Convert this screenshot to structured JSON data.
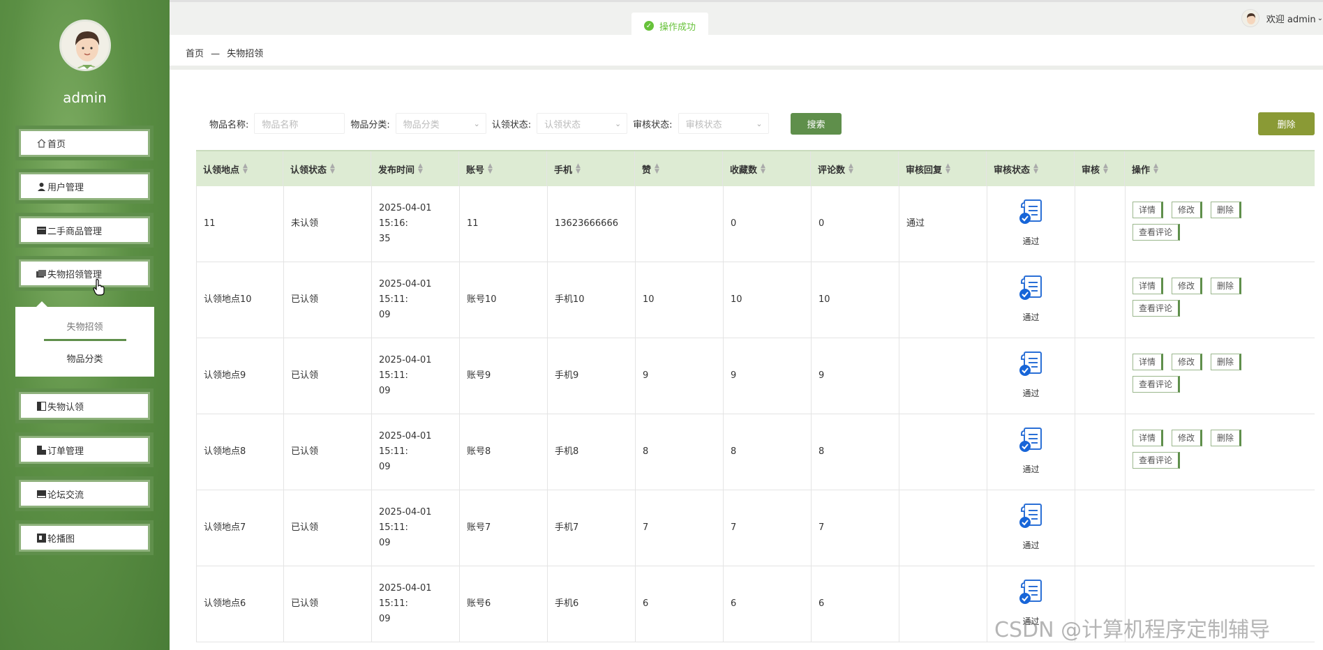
{
  "sidebar": {
    "username": "admin",
    "items": [
      {
        "label": "首页",
        "icon": "home-icon"
      },
      {
        "label": "用户管理",
        "icon": "user-icon"
      },
      {
        "label": "二手商品管理",
        "icon": "goods-icon"
      },
      {
        "label": "失物招领管理",
        "icon": "folder-icon"
      },
      {
        "label": "失物认领",
        "icon": "claim-icon"
      },
      {
        "label": "订单管理",
        "icon": "order-icon"
      },
      {
        "label": "论坛交流",
        "icon": "forum-icon"
      },
      {
        "label": "轮播图",
        "icon": "carousel-icon"
      }
    ],
    "submenu": [
      "失物招领",
      "物品分类"
    ]
  },
  "topbar": {
    "toast": "操作成功",
    "welcome": "欢迎 admin"
  },
  "breadcrumb": {
    "home": "首页",
    "sep": "—",
    "current": "失物招领"
  },
  "search": {
    "name_label": "物品名称:",
    "name_placeholder": "物品名称",
    "category_label": "物品分类:",
    "category_placeholder": "物品分类",
    "claim_label": "认领状态:",
    "claim_placeholder": "认领状态",
    "audit_label": "审核状态:",
    "audit_placeholder": "审核状态",
    "search_button": "搜索",
    "delete_button": "删除"
  },
  "table": {
    "headers": [
      "认领地点",
      "认领状态",
      "发布时间",
      "账号",
      "手机",
      "赞",
      "收藏数",
      "评论数",
      "审核回复",
      "审核状态",
      "审核",
      "操作"
    ],
    "rows": [
      {
        "place": "11",
        "status": "未认领",
        "time1": "2025-04-01 15:16:",
        "time2": "35",
        "account": "11",
        "phone": "13623666666",
        "likes": "",
        "favs": "0",
        "comments": "0",
        "reply": "通过",
        "audit": "通过"
      },
      {
        "place": "认领地点10",
        "status": "已认领",
        "time1": "2025-04-01 15:11:",
        "time2": "09",
        "account": "账号10",
        "phone": "手机10",
        "likes": "10",
        "favs": "10",
        "comments": "10",
        "reply": "",
        "audit": "通过"
      },
      {
        "place": "认领地点9",
        "status": "已认领",
        "time1": "2025-04-01 15:11:",
        "time2": "09",
        "account": "账号9",
        "phone": "手机9",
        "likes": "9",
        "favs": "9",
        "comments": "9",
        "reply": "",
        "audit": "通过"
      },
      {
        "place": "认领地点8",
        "status": "已认领",
        "time1": "2025-04-01 15:11:",
        "time2": "09",
        "account": "账号8",
        "phone": "手机8",
        "likes": "8",
        "favs": "8",
        "comments": "8",
        "reply": "",
        "audit": "通过"
      },
      {
        "place": "认领地点7",
        "status": "已认领",
        "time1": "2025-04-01 15:11:",
        "time2": "09",
        "account": "账号7",
        "phone": "手机7",
        "likes": "7",
        "favs": "7",
        "comments": "7",
        "reply": "",
        "audit": "通过"
      },
      {
        "place": "认领地点6",
        "status": "已认领",
        "time1": "2025-04-01 15:11:",
        "time2": "09",
        "account": "账号6",
        "phone": "手机6",
        "likes": "6",
        "favs": "6",
        "comments": "6",
        "reply": "",
        "audit": "通过"
      }
    ],
    "ops": {
      "detail": "详情",
      "edit": "修改",
      "delete": "删除",
      "comments": "查看评论"
    }
  },
  "watermark": "CSDN @计算机程序定制辅导"
}
